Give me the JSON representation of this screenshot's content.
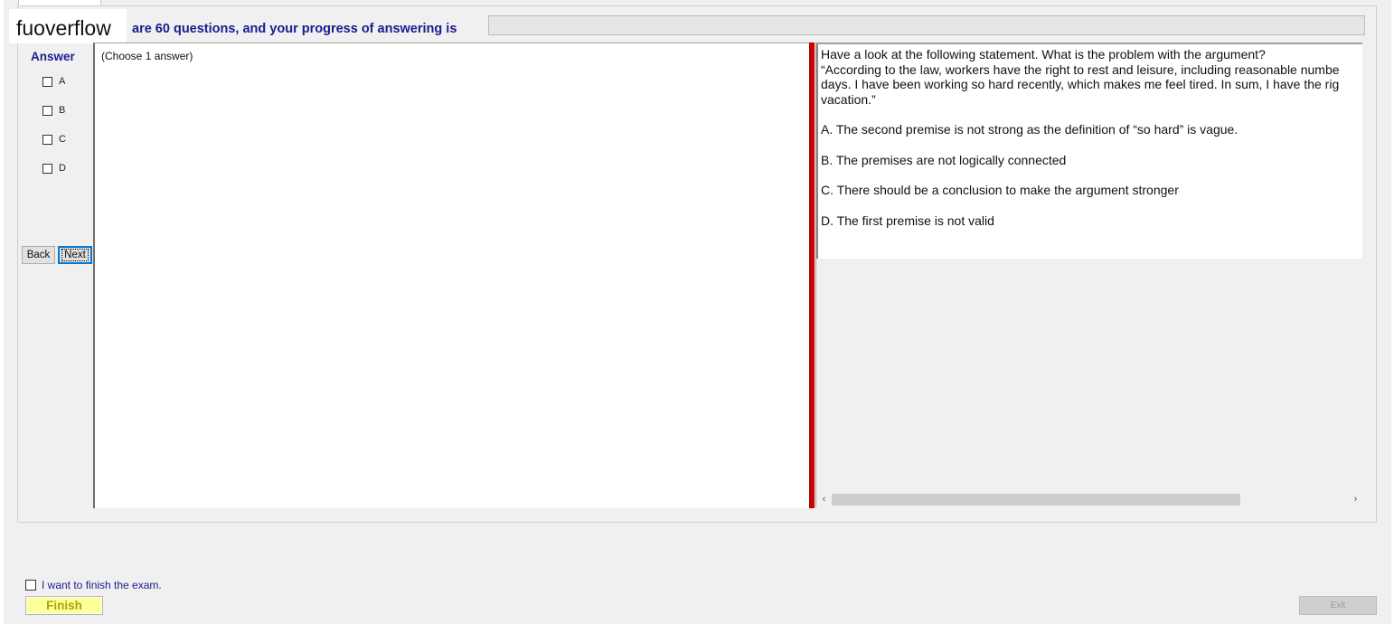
{
  "brand": "fuoverflow",
  "header": {
    "progress_text": "are 60 questions, and your progress of answering is",
    "progress_fraction": 0
  },
  "answer_panel": {
    "title": "Answer",
    "options": [
      "A",
      "B",
      "C",
      "D"
    ],
    "choose_hint": "(Choose 1 answer)"
  },
  "nav": {
    "back_label": "Back",
    "next_label": "Next"
  },
  "question": {
    "lines": [
      "Have a look at the following statement. What is the problem with the argument?",
      "“According to the law, workers have the right to rest and leisure, including reasonable numbe",
      "days. I have been working so hard recently, which makes me feel tired. In sum, I have the rig",
      "vacation.”"
    ],
    "choices": [
      "A.  The second premise is not strong as the definition of “so hard” is vague.",
      "B.  The premises are not logically connected",
      "C.  There should be a conclusion to make the argument stronger",
      "D.  The first premise is not valid"
    ]
  },
  "footer": {
    "finish_check_label": "I want to finish the exam.",
    "finish_label": "Finish",
    "exit_label": "Exit"
  },
  "icons": {
    "scroll_left": "‹",
    "scroll_right": "›"
  }
}
